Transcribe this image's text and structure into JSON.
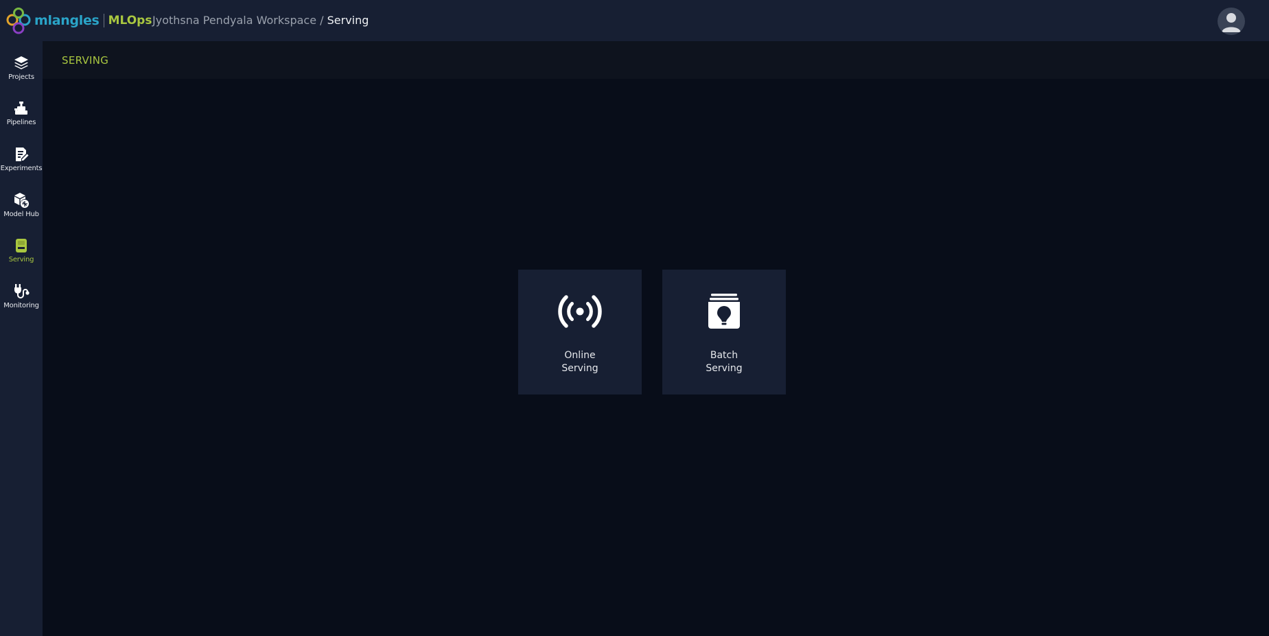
{
  "header": {
    "logo_primary": "mlangles",
    "logo_secondary": "MLOps",
    "workspace": "Jyothsna Pendyala Workspace /",
    "current_page": "Serving"
  },
  "sidebar": {
    "items": [
      {
        "label": "Projects",
        "icon": "layers-icon"
      },
      {
        "label": "Pipelines",
        "icon": "pipeline-icon"
      },
      {
        "label": "Experiments",
        "icon": "experiment-icon"
      },
      {
        "label": "Model Hub",
        "icon": "model-hub-icon"
      },
      {
        "label": "Serving",
        "icon": "serving-icon",
        "active": true
      },
      {
        "label": "Monitoring",
        "icon": "monitoring-icon"
      }
    ]
  },
  "page": {
    "title": "SERVING"
  },
  "cards": [
    {
      "line1": "Online",
      "line2": "Serving",
      "icon": "broadcast-icon"
    },
    {
      "line1": "Batch",
      "line2": "Serving",
      "icon": "batch-box-icon"
    }
  ],
  "colors": {
    "accent": "#a9c740",
    "background": "#080d19",
    "panel": "#171f33",
    "logo_blue": "#2aa4c8"
  }
}
